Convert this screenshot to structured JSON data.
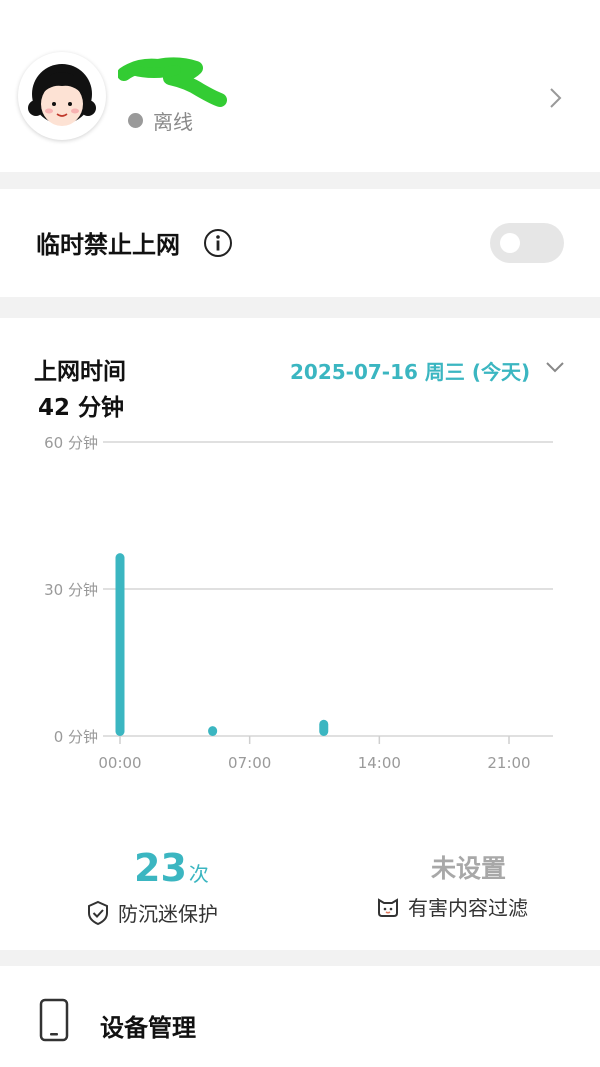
{
  "profile": {
    "status_text": "离线",
    "status_color": "#9a9a9a",
    "name_redaction_color": "#33cc33"
  },
  "temp_block": {
    "label": "临时禁止上网",
    "toggle_on": false
  },
  "usage": {
    "title": "上网时间",
    "total": "42 分钟",
    "date": "2025-07-16 周三 (今天)",
    "accent_color": "#3bb6c1"
  },
  "chart_data": {
    "type": "bar",
    "y_tick_labels": [
      "60 分钟",
      "30 分钟",
      "0 分钟"
    ],
    "x_tick_labels": [
      "00:00",
      "07:00",
      "14:00",
      "21:00"
    ],
    "ylim": [
      0,
      60
    ],
    "xlim_hours": [
      0,
      23
    ],
    "unit": "分钟",
    "bars": [
      {
        "time": "00:00",
        "minutes": 36.5
      },
      {
        "time": "05:00",
        "minutes": 1.2
      },
      {
        "time": "11:00",
        "minutes": 2.5
      }
    ],
    "grid": true,
    "color": "#3bb6c1"
  },
  "stats": {
    "protection_count": "23",
    "protection_unit": "次",
    "protection_label": "防沉迷保护",
    "filter_status": "未设置",
    "filter_label": "有害内容过滤"
  },
  "device": {
    "label": "设备管理"
  },
  "icons": {
    "chevron": "chevron-right-icon",
    "info": "info-icon",
    "dropdown": "chevron-down-icon",
    "shield": "shield-check-icon",
    "filter": "cat-face-icon",
    "device": "phone-icon"
  }
}
